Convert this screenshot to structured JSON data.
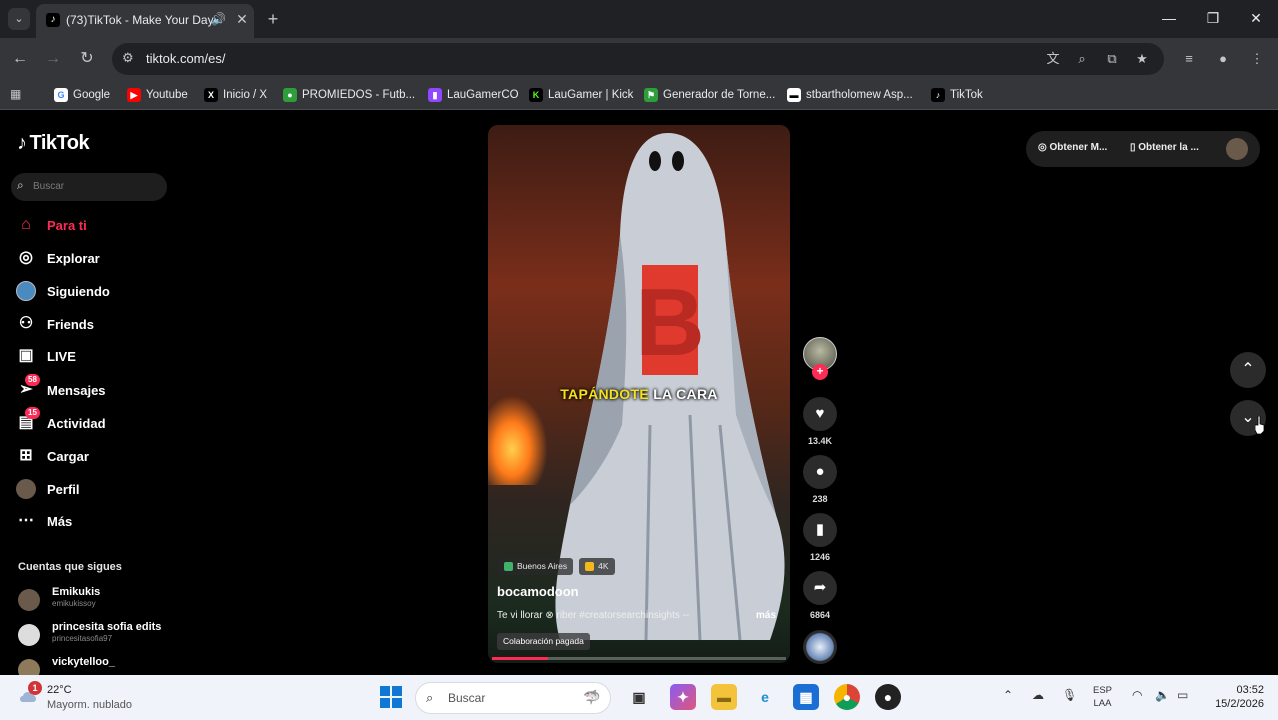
{
  "browser": {
    "tab_title": "(73)TikTok - Make Your Day",
    "url": "tiktok.com/es/",
    "bookmarks": [
      {
        "label": "Google",
        "icon": "google-icon",
        "color": "#ffffff"
      },
      {
        "label": "Youtube",
        "icon": "youtube-icon",
        "color": "#ff0000"
      },
      {
        "label": "Inicio / X",
        "icon": "x-icon",
        "color": "#000000"
      },
      {
        "label": "PROMIEDOS - Futb...",
        "icon": "promiedos-icon",
        "color": "#2e9e3a"
      },
      {
        "label": "LauGamerCO",
        "icon": "twitch-icon",
        "color": "#9146ff"
      },
      {
        "label": "LauGamer | Kick",
        "icon": "kick-icon",
        "color": "#53fc18"
      },
      {
        "label": "Generador de Torne...",
        "icon": "generator-icon",
        "color": "#2e9e3a"
      },
      {
        "label": "stbartholomew Asp...",
        "icon": "stbartholomew-icon",
        "color": "#ffffff"
      },
      {
        "label": "TikTok",
        "icon": "tiktok-icon",
        "color": "#000000"
      }
    ]
  },
  "tiktok": {
    "logo": "TikTok",
    "search_placeholder": "Buscar",
    "nav": [
      {
        "label": "Para ti",
        "icon": "home-icon",
        "active": true
      },
      {
        "label": "Explorar",
        "icon": "compass-icon"
      },
      {
        "label": "Siguiendo",
        "icon": "following-icon"
      },
      {
        "label": "Friends",
        "icon": "friends-icon"
      },
      {
        "label": "LIVE",
        "icon": "live-icon"
      },
      {
        "label": "Mensajes",
        "icon": "messages-icon",
        "badge": "58"
      },
      {
        "label": "Actividad",
        "icon": "activity-icon",
        "badge": "15"
      },
      {
        "label": "Cargar",
        "icon": "upload-icon"
      },
      {
        "label": "Perfil",
        "icon": "profile-icon"
      },
      {
        "label": "Más",
        "icon": "more-icon"
      }
    ],
    "following_title": "Cuentas que sigues",
    "following": [
      {
        "name": "Emikukis",
        "handle": "emikukissoy"
      },
      {
        "name": "princesita sofia edits",
        "handle": "princesitasofia97"
      },
      {
        "name": "vickytelloo_",
        "handle": ""
      }
    ],
    "top_right": {
      "get_app1": "Obtener M...",
      "get_app2": "Obtener la ..."
    },
    "video": {
      "caption_highlight": "TAPÁNDOTE",
      "caption_rest": " LA CARA",
      "location_chip": "Buenos Aires",
      "quality_chip": "4K",
      "author": "bocamodoon",
      "description": "Te vi llorar ⊗ riber #creatorsearchinsights --",
      "more": "más",
      "paid_label": "Colaboración pagada",
      "progress": 0.19,
      "likes": "13.4K",
      "comments": "238",
      "saves": "1246",
      "shares": "6864"
    }
  },
  "taskbar": {
    "weather_badge": "1",
    "temperature": "22°C",
    "weather_desc": "Mayorm. nublado",
    "search_placeholder": "Buscar",
    "lang_top": "ESP",
    "lang_bottom": "LAA",
    "time": "03:52",
    "date": "15/2/2026"
  },
  "colors": {
    "accent": "#fe2c55",
    "caption_highlight": "#f5e21b",
    "ghost_letter": "#e03a2e"
  }
}
